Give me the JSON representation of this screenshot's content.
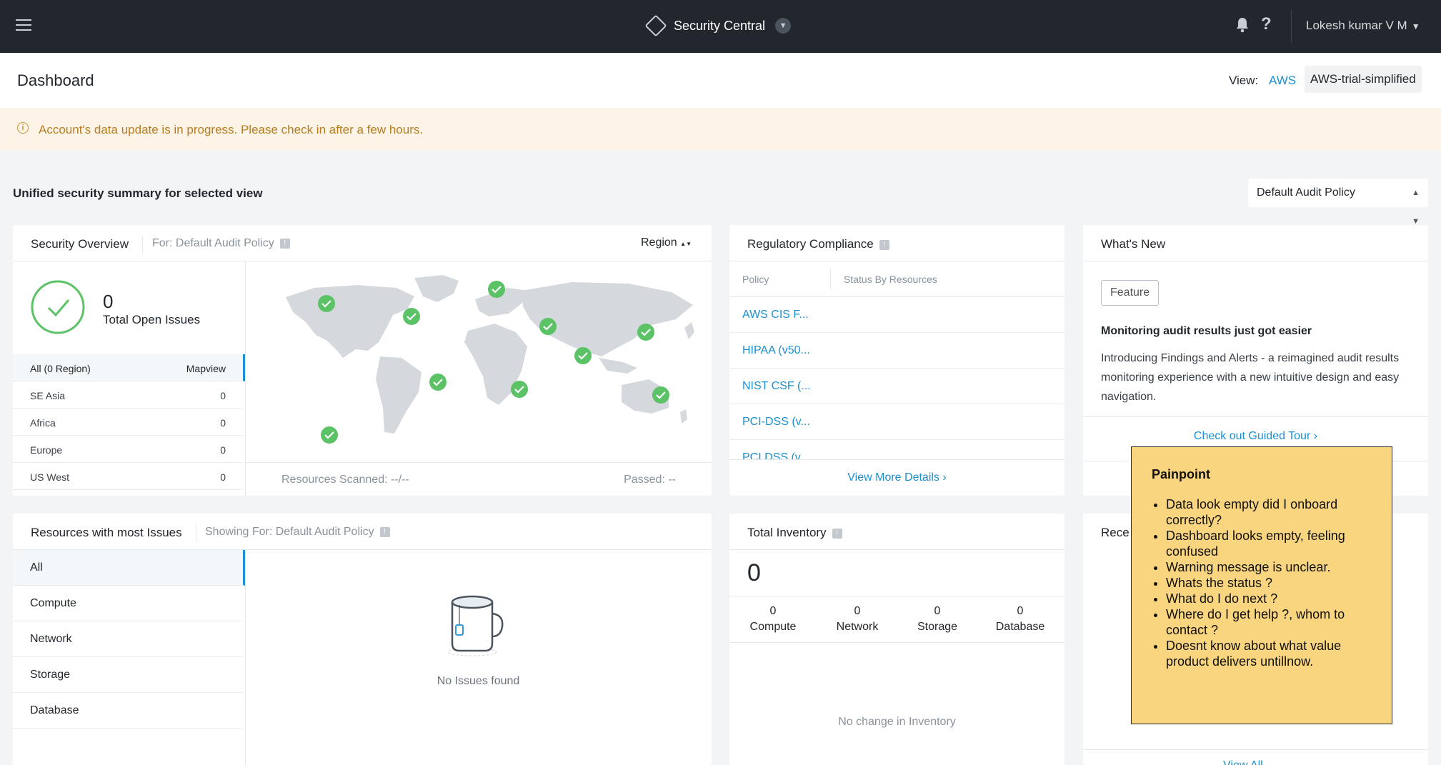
{
  "topbar": {
    "app_name": "Security Central",
    "user_name": "Lokesh kumar V M",
    "help_label": "?"
  },
  "header": {
    "title": "Dashboard",
    "view_label": "View:",
    "view_cloud": "AWS",
    "view_name": "AWS-trial-simplified"
  },
  "banner": {
    "message": "Account's data update is in progress. Please check in after a few hours."
  },
  "summary": {
    "title": "Unified security summary for selected view",
    "policy_select": "Default Audit Policy"
  },
  "security_overview": {
    "title": "Security Overview",
    "subtitle": "For: Default Audit Policy",
    "region_dropdown": "Region",
    "open_issues_count": "0",
    "open_issues_label": "Total Open Issues",
    "list_header_left": "All (0 Region)",
    "list_header_right": "Mapview",
    "regions": [
      {
        "name": "SE Asia",
        "value": "0"
      },
      {
        "name": "Africa",
        "value": "0"
      },
      {
        "name": "Europe",
        "value": "0"
      },
      {
        "name": "US West",
        "value": "0"
      }
    ],
    "resources_scanned": "Resources Scanned: --/--",
    "passed": "Passed: --"
  },
  "regulatory_compliance": {
    "title": "Regulatory Compliance",
    "col_policy": "Policy",
    "col_status": "Status By Resources",
    "policies": [
      "AWS CIS F...",
      "HIPAA (v50...",
      "NIST CSF (...",
      "PCI-DSS (v...",
      "PCI DSS (v..."
    ],
    "view_more": "View More Details"
  },
  "whats_new": {
    "title": "What's New",
    "tag": "Feature",
    "headline": "Monitoring audit results just got easier",
    "body": "Introducing Findings and Alerts - a reimagined audit results monitoring experience with a new intuitive design and easy navigation.",
    "tour_link": "Check out Guided Tour"
  },
  "resources_issues": {
    "title": "Resources with most Issues",
    "subtitle": "Showing For: Default Audit Policy",
    "categories": [
      "All",
      "Compute",
      "Network",
      "Storage",
      "Database"
    ],
    "empty_message": "No Issues found"
  },
  "total_inventory": {
    "title": "Total Inventory",
    "total": "0",
    "columns": [
      {
        "value": "0",
        "label": "Compute"
      },
      {
        "value": "0",
        "label": "Network"
      },
      {
        "value": "0",
        "label": "Storage"
      },
      {
        "value": "0",
        "label": "Database"
      }
    ],
    "empty_message": "No change in Inventory"
  },
  "recent_card": {
    "title_partial": "Rece",
    "link_partial": "View All"
  },
  "painpoint": {
    "title": "Painpoint",
    "items": [
      "Data look empty did I onboard correctly?",
      "Dashboard looks empty, feeling confused",
      "Warning message is unclear.",
      "Whats the status ?",
      "What do I do next ?",
      "Where do I get help ?, whom to contact ?",
      "Doesnt know about what value product delivers untillnow."
    ]
  },
  "colors": {
    "topbar": "#22272e",
    "accent": "#1b8fd2",
    "success": "#5cc266",
    "warning_bg": "#fdf3e6",
    "warning_text": "#b87d1f",
    "sticky": "#fad580"
  }
}
